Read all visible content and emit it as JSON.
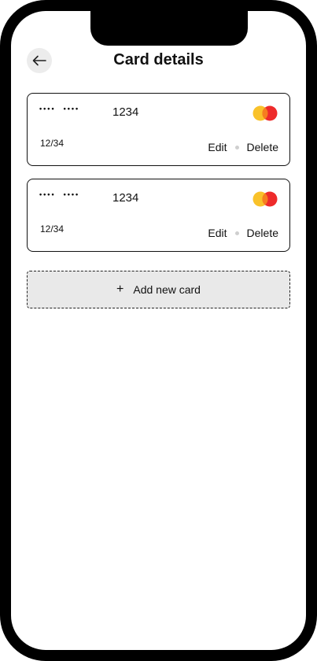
{
  "header": {
    "title": "Card details",
    "back_icon": "arrow-left-icon"
  },
  "cards": [
    {
      "masked_groups": [
        "••••",
        "••••"
      ],
      "last4": "1234",
      "expiry": "12/34",
      "brand_icon": "mastercard-logo",
      "edit_label": "Edit",
      "delete_label": "Delete"
    },
    {
      "masked_groups": [
        "••••",
        "••••"
      ],
      "last4": "1234",
      "expiry": "12/34",
      "brand_icon": "mastercard-logo",
      "edit_label": "Edit",
      "delete_label": "Delete"
    }
  ],
  "add_card": {
    "label": "Add new card",
    "icon": "plus-icon"
  },
  "colors": {
    "brand_yellow": "#F9C22A",
    "brand_red": "#EE2B2B",
    "separator": "#CFCFCF",
    "add_bg": "#E9E9E9"
  }
}
